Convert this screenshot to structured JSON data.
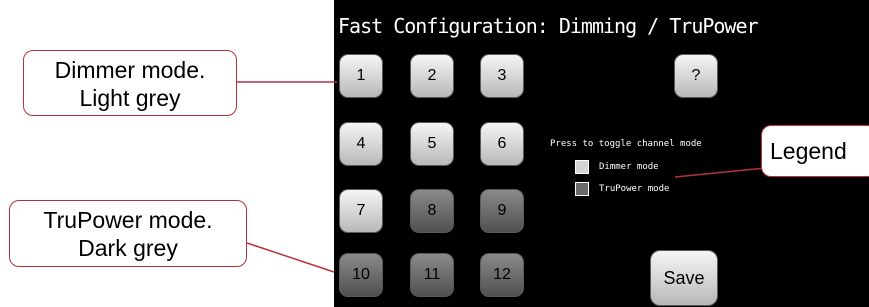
{
  "screen": {
    "title": "Fast Configuration: Dimming / TruPower",
    "channels": [
      {
        "label": "1",
        "mode": "dimmer"
      },
      {
        "label": "2",
        "mode": "dimmer"
      },
      {
        "label": "3",
        "mode": "dimmer"
      },
      {
        "label": "4",
        "mode": "dimmer"
      },
      {
        "label": "5",
        "mode": "dimmer"
      },
      {
        "label": "6",
        "mode": "dimmer"
      },
      {
        "label": "7",
        "mode": "dimmer"
      },
      {
        "label": "8",
        "mode": "trupower"
      },
      {
        "label": "9",
        "mode": "trupower"
      },
      {
        "label": "10",
        "mode": "trupower"
      },
      {
        "label": "11",
        "mode": "trupower"
      },
      {
        "label": "12",
        "mode": "trupower"
      }
    ],
    "help_label": "?",
    "save_label": "Save",
    "legend": {
      "hint": "Press to toggle channel mode",
      "dimmer_label": "Dimmer mode",
      "trupower_label": "TruPower mode"
    }
  },
  "callouts": {
    "dimmer": {
      "line1": "Dimmer mode.",
      "line2": "Light grey"
    },
    "trupower": {
      "line1": "TruPower mode.",
      "line2": "Dark grey"
    },
    "legend": {
      "line1": "Legend"
    }
  },
  "colors": {
    "screen_bg": "#000000",
    "dimmer_fill": "#d4d4d4",
    "trupower_fill": "#6a6a6a",
    "callout_border": "#b5323c"
  }
}
